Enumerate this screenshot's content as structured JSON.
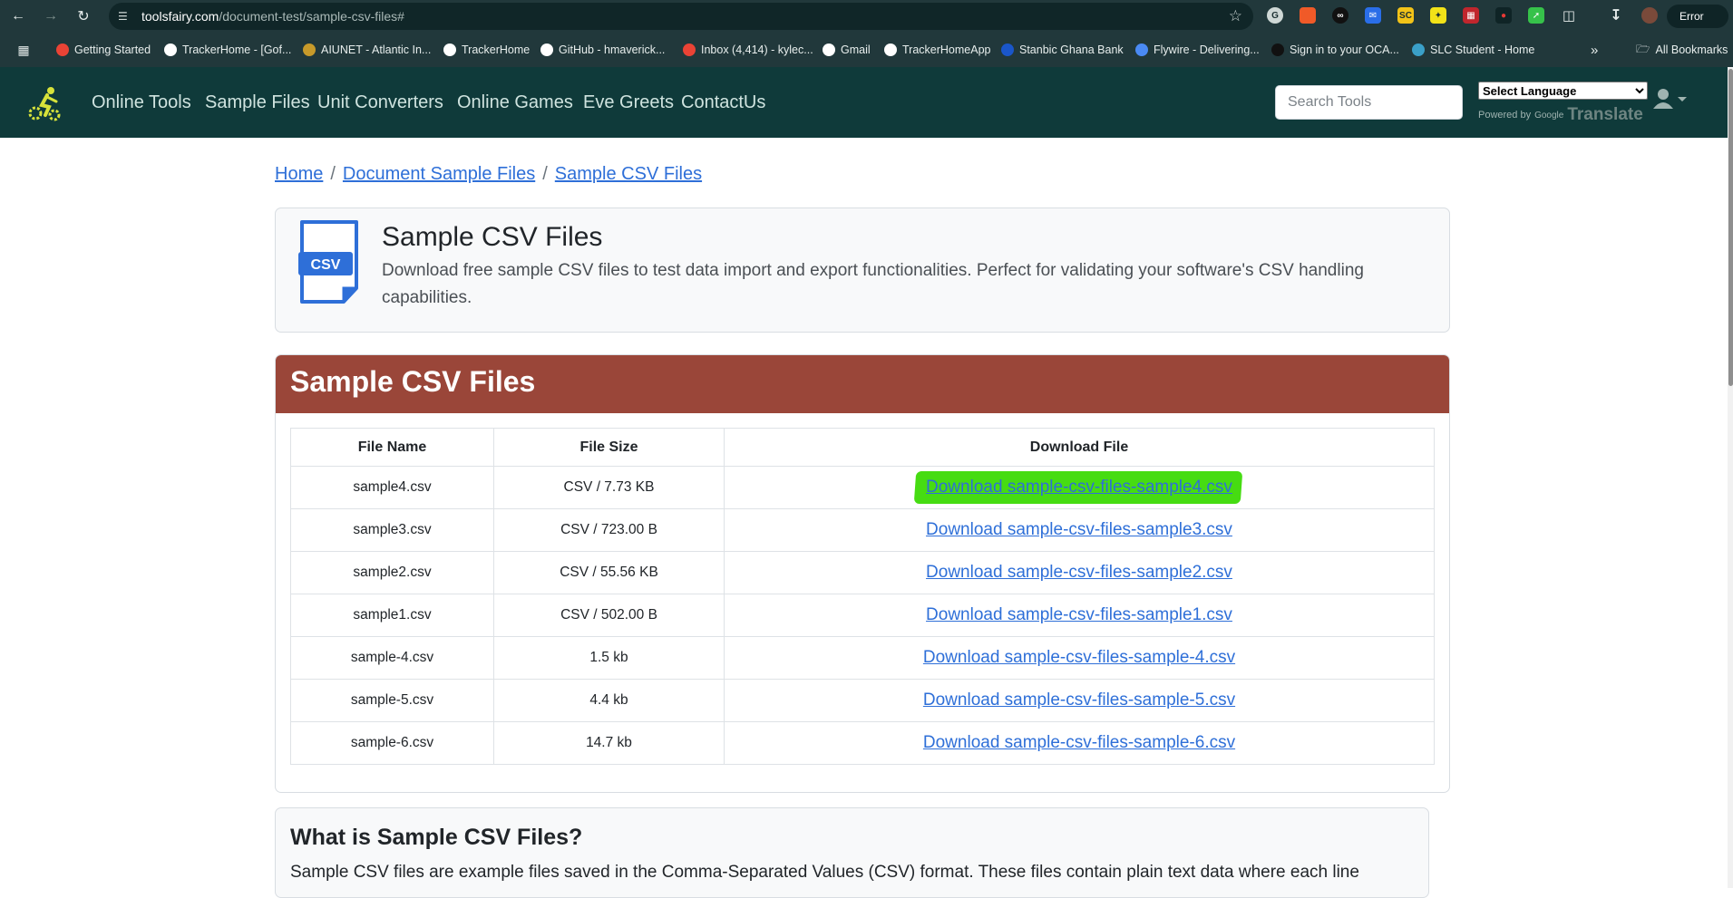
{
  "browser": {
    "url_host": "toolsfairy.com",
    "url_path": "/document-test/sample-csv-files#",
    "error_label": "Error",
    "bookmarks": [
      {
        "label": "Getting Started",
        "color": "#ea4335"
      },
      {
        "label": "TrackerHome - [Gof...",
        "color": "#ffffff"
      },
      {
        "label": "AIUNET - Atlantic In...",
        "color": "#c79a2a"
      },
      {
        "label": "TrackerHome",
        "color": "#ffffff"
      },
      {
        "label": "GitHub - hmaverick...",
        "color": "#ffffff"
      },
      {
        "label": "Inbox (4,414) - kylec...",
        "color": "#ea4335"
      },
      {
        "label": "Gmail",
        "color": "#ffffff"
      },
      {
        "label": "TrackerHomeApp",
        "color": "#ffffff"
      },
      {
        "label": "Stanbic Ghana Bank",
        "color": "#1a56c9"
      },
      {
        "label": "Flywire - Delivering...",
        "color": "#4a8af4"
      },
      {
        "label": "Sign in to your OCA...",
        "color": "#111111"
      },
      {
        "label": "SLC Student - Home",
        "color": "#3aa0c8"
      }
    ],
    "all_bookmarks_label": "All Bookmarks"
  },
  "site": {
    "nav": [
      "Online Tools",
      "Sample Files",
      "Unit Converters",
      "Online Games",
      "Eve Greets",
      "ContactUs"
    ],
    "search_placeholder": "Search Tools",
    "language_selected": "Select Language",
    "powered_by": "Powered by",
    "google": "Google",
    "translate": "Translate"
  },
  "breadcrumb": {
    "home": "Home",
    "document": "Document Sample Files",
    "current": "Sample CSV Files",
    "separator": "/"
  },
  "hero": {
    "icon_label": "CSV",
    "title": "Sample CSV Files",
    "description": "Download free sample CSV files to test data import and export functionalities. Perfect for validating your software's CSV handling capabilities."
  },
  "files_panel": {
    "title": "Sample CSV Files",
    "columns": [
      "File Name",
      "File Size",
      "Download File"
    ],
    "rows": [
      {
        "name": "sample4.csv",
        "size": "CSV / 7.73 KB",
        "link": "Download sample-csv-files-sample4.csv"
      },
      {
        "name": "sample3.csv",
        "size": "CSV / 723.00 B",
        "link": "Download sample-csv-files-sample3.csv"
      },
      {
        "name": "sample2.csv",
        "size": "CSV / 55.56 KB",
        "link": "Download sample-csv-files-sample2.csv"
      },
      {
        "name": "sample1.csv",
        "size": "CSV / 502.00 B",
        "link": "Download sample-csv-files-sample1.csv"
      },
      {
        "name": "sample-4.csv",
        "size": "1.5 kb",
        "link": "Download sample-csv-files-sample-4.csv"
      },
      {
        "name": "sample-5.csv",
        "size": "4.4 kb",
        "link": "Download sample-csv-files-sample-5.csv"
      },
      {
        "name": "sample-6.csv",
        "size": "14.7 kb",
        "link": "Download sample-csv-files-sample-6.csv"
      }
    ]
  },
  "about": {
    "title": "What is Sample CSV Files?",
    "text": "Sample CSV files are example files saved in the Comma-Separated Values (CSV) format. These files contain plain text data where each line"
  },
  "colors": {
    "chrome": "#21383b",
    "site_nav": "#0f3a3a",
    "panel_header": "#9a4639",
    "link": "#2e6fd8",
    "highlight": "#46dc12"
  }
}
